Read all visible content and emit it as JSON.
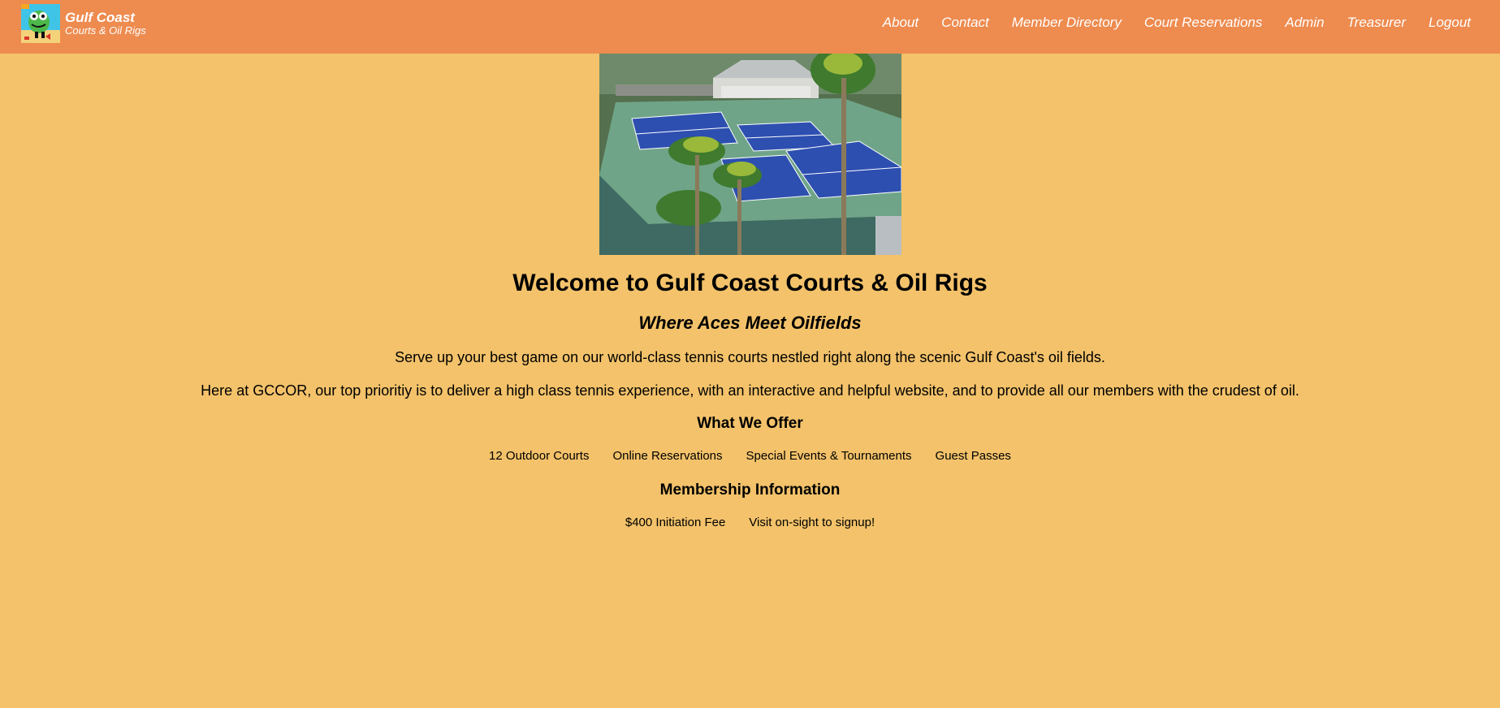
{
  "brand": {
    "title": "Gulf Coast",
    "subtitle": "Courts & Oil Rigs"
  },
  "nav": {
    "items": [
      {
        "label": "About"
      },
      {
        "label": "Contact"
      },
      {
        "label": "Member Directory"
      },
      {
        "label": "Court Reservations"
      },
      {
        "label": "Admin"
      },
      {
        "label": "Treasurer"
      },
      {
        "label": "Logout"
      }
    ]
  },
  "main": {
    "heading": "Welcome to Gulf Coast Courts & Oil Rigs",
    "tagline": "Where Aces Meet Oilfields",
    "paragraph1": "Serve up your best game on our world-class tennis courts nestled right along the scenic Gulf Coast's oil fields.",
    "paragraph2": "Here at GCCOR, our top prioritiy is to deliver a high class tennis experience, with an interactive and helpful website, and to provide all our members with the crudest of oil.",
    "offer_heading": "What We Offer",
    "offers": [
      "12 Outdoor Courts",
      "Online Reservations",
      "Special Events & Tournaments",
      "Guest Passes"
    ],
    "membership_heading": "Membership Information",
    "membership": [
      "$400 Initiation Fee",
      "Visit on-sight to signup!"
    ]
  },
  "colors": {
    "page_background": "#F3C26A",
    "navbar_background": "#EE8B4F",
    "nav_text": "#FFFFFF",
    "court_blue": "#2D4FB0",
    "court_green": "#6FA488"
  }
}
